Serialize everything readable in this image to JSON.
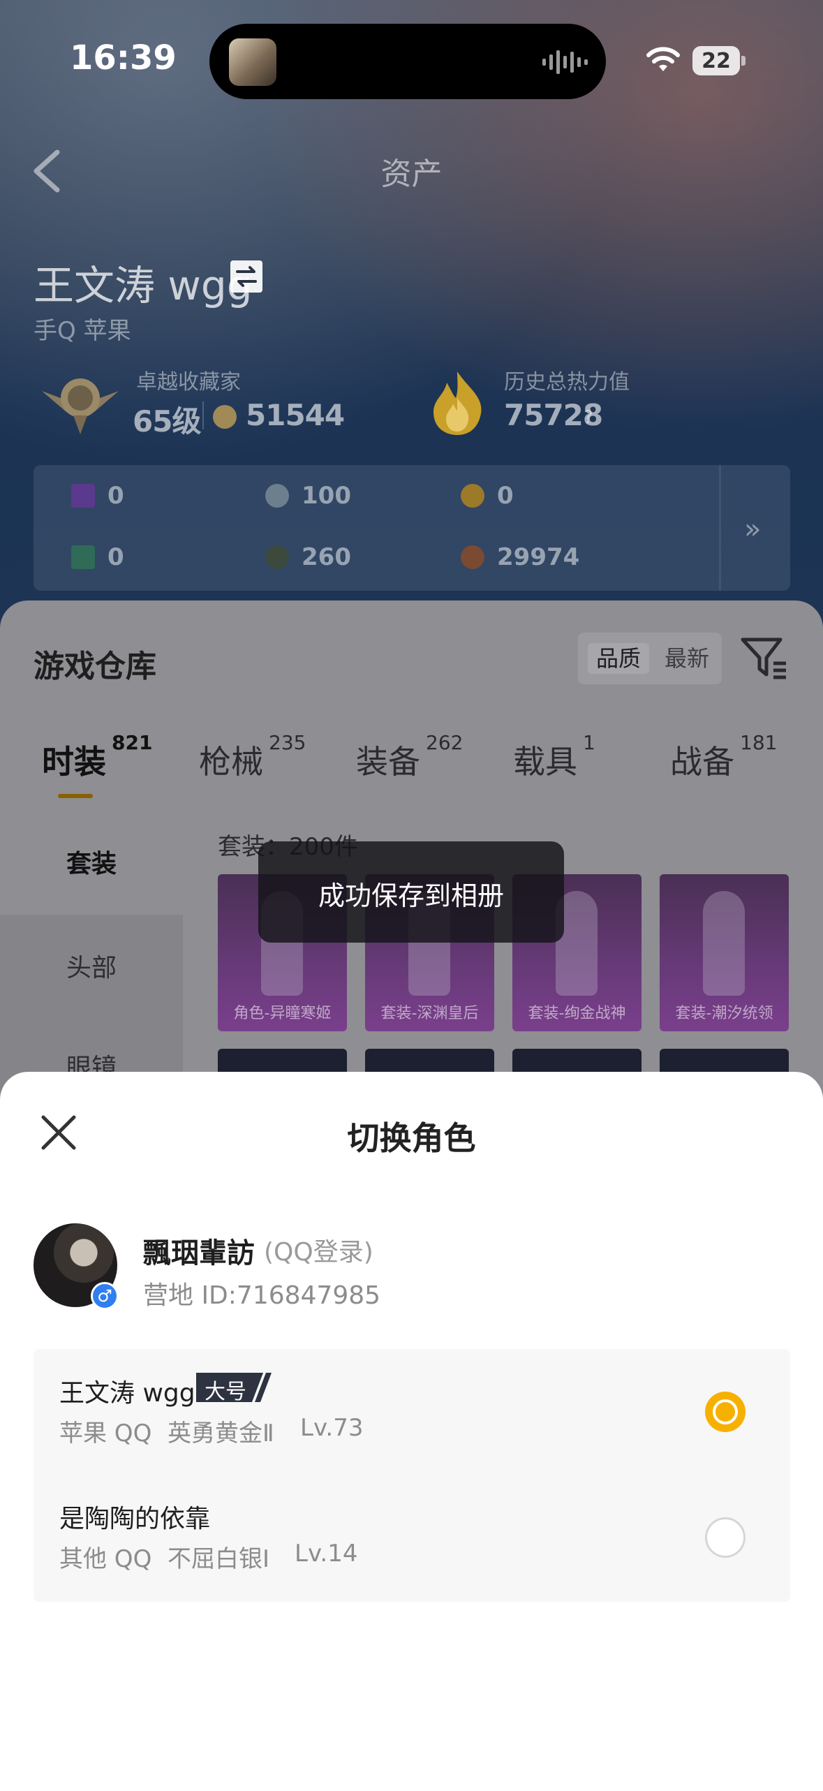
{
  "status_bar": {
    "time": "16:39",
    "battery": "22"
  },
  "header": {
    "title": "资产"
  },
  "player": {
    "name": "王文涛 wgg",
    "platform": "手Q 苹果",
    "tag": "",
    "collector_label": "卓越收藏家",
    "level": "65级",
    "coins": "51544",
    "heat_label": "历史总热力值",
    "heat_value": "75728",
    "heat_help": "?"
  },
  "currencies": [
    {
      "icon": "purple-card-icon",
      "value": "0",
      "color": "#5a3a8c"
    },
    {
      "icon": "silver-coin-icon",
      "value": "100",
      "color": "#6d7f8c"
    },
    {
      "icon": "gold-coin-icon",
      "value": "0",
      "color": "#9c7a2a"
    },
    {
      "icon": "green-card-icon",
      "value": "0",
      "color": "#2f6b57"
    },
    {
      "icon": "dark-orb-icon",
      "value": "260",
      "color": "#3b4a3c"
    },
    {
      "icon": "bronze-orb-icon",
      "value": "29974",
      "color": "#7a4a32"
    }
  ],
  "more_arrow": "»",
  "warehouse": {
    "title": "游戏仓库",
    "sort_quality": "品质",
    "sort_latest": "最新",
    "tabs": [
      {
        "label": "时装",
        "count": "821"
      },
      {
        "label": "枪械",
        "count": "235"
      },
      {
        "label": "装备",
        "count": "262"
      },
      {
        "label": "载具",
        "count": "1"
      },
      {
        "label": "战备",
        "count": "181"
      }
    ],
    "side_items": [
      "套装",
      "头部",
      "眼镜"
    ],
    "set_count": "套装：200件",
    "cards": [
      "角色-异瞳寒姬",
      "套装-深渊皇后",
      "套装-绚金战神",
      "套装-潮汐统领"
    ]
  },
  "toast": "成功保存到相册",
  "sheet": {
    "title": "切换角色",
    "account_name": "飄�squo;珚輩訪",
    "account_login": "(QQ登录)",
    "account_id": "营地 ID:716847985",
    "gender": "♂",
    "roles": [
      {
        "name": "王文涛 wgg",
        "badge": "大号",
        "platform": "苹果 QQ",
        "rank": "英勇黄金Ⅱ",
        "level": "Lv.73",
        "selected": true
      },
      {
        "name": "是陶陶的依靠",
        "badge": "",
        "platform": "其他 QQ",
        "rank": "不屈白银Ⅰ",
        "level": "Lv.14",
        "selected": false
      }
    ]
  },
  "colors": {
    "accent": "#f6b100",
    "link": "#2a7fd4",
    "badge": "#2d3340"
  }
}
